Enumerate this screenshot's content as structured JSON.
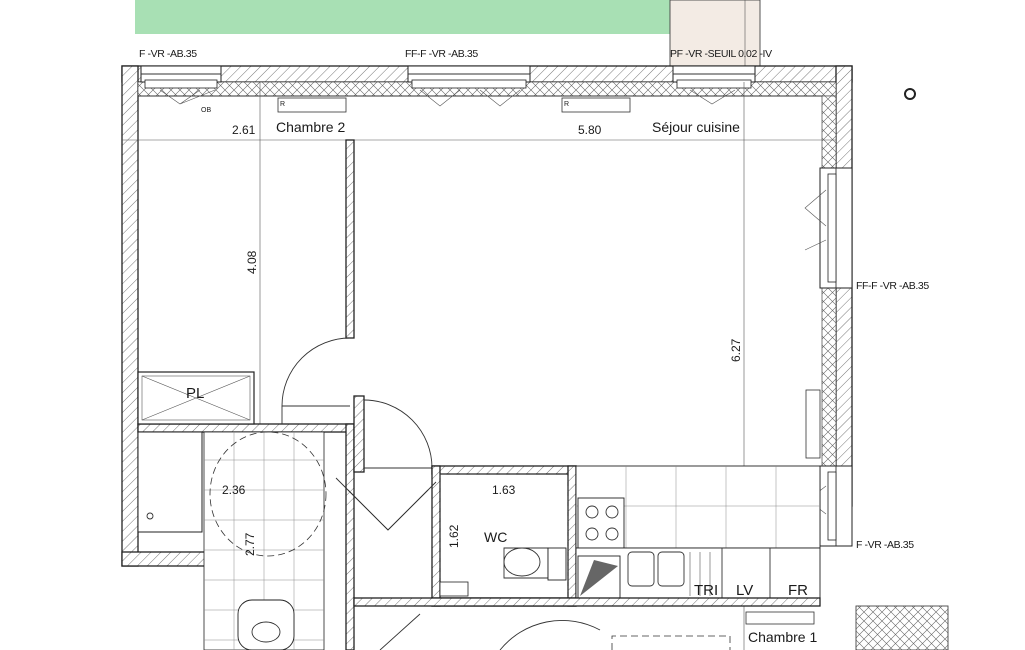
{
  "rooms": {
    "chambre2": "Chambre 2",
    "sejour": "Séjour cuisine",
    "chambre1": "Chambre 1",
    "wc": "WC",
    "placard": "PL"
  },
  "dimensions": {
    "ch2_width": "2.61",
    "ch2_depth": "4.08",
    "sejour_width": "5.80",
    "sejour_depth": "6.27",
    "wc_width": "1.63",
    "wc_depth": "1.62",
    "bath_width": "2.36",
    "bath_depth": "2.77"
  },
  "windows": {
    "w1": "F -VR -AB.35",
    "w2": "FF-F -VR -AB.35",
    "w3": "PF -VR -SEUIL 0.02 -IV",
    "w4": "FF-F -VR -AB.35",
    "w5": "F -VR -AB.35"
  },
  "appliances": {
    "tri": "TRI",
    "lv": "LV",
    "fr": "FR",
    "ob": "OB",
    "r": "R"
  },
  "colors": {
    "garden": "#a8e0b4",
    "walls": "#222222"
  }
}
